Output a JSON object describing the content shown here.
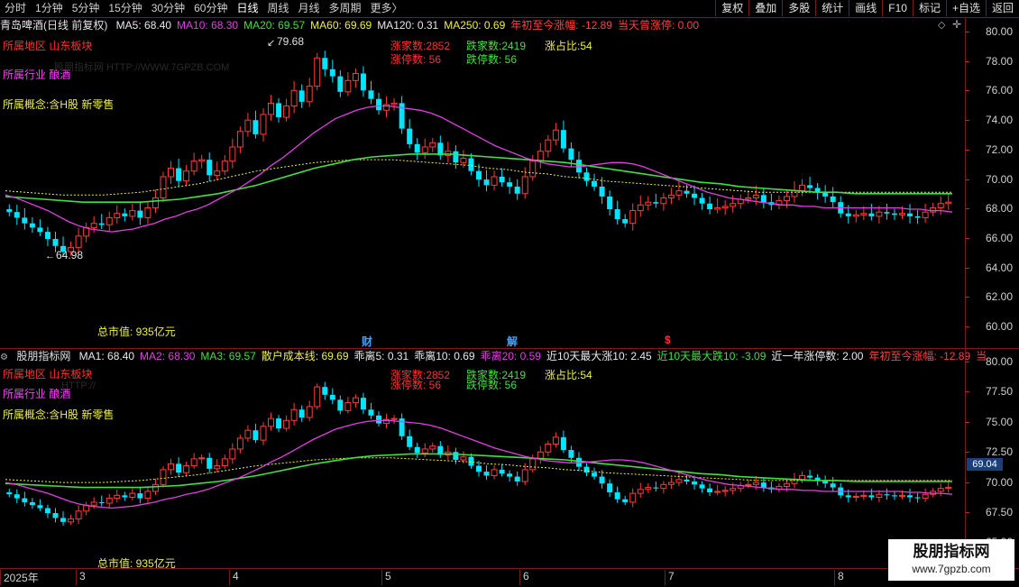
{
  "toolbar": {
    "periods": [
      "分时",
      "1分钟",
      "5分钟",
      "15分钟",
      "30分钟",
      "60分钟",
      "日线",
      "周线",
      "月线",
      "多周期",
      "更多〉"
    ],
    "active_period": "日线",
    "buttons": [
      "复权",
      "叠加",
      "多股",
      "统计",
      "画线",
      "F10",
      "标记",
      "+自选",
      "返回"
    ]
  },
  "main_header": {
    "title": "青岛啤酒(日线 前复权)",
    "items": [
      {
        "label": "MA5: 68.40",
        "color": "#e8e8e8"
      },
      {
        "label": "MA10: 68.30",
        "color": "#e040e0"
      },
      {
        "label": "MA20: 69.57",
        "color": "#40e040"
      },
      {
        "label": "MA60: 69.69",
        "color": "#f0f040"
      },
      {
        "label": "MA120: 0.31",
        "color": "#e8e8e8"
      },
      {
        "label": "MA250: 0.69",
        "color": "#f0f040"
      },
      {
        "label": "年初至今涨幅: -12.89",
        "color": "#ff4040"
      },
      {
        "label": "当天曾涨停: 0.00",
        "color": "#ff4040"
      }
    ]
  },
  "sub_header": {
    "title": "股朋指标网",
    "items": [
      {
        "label": "MA1: 68.40",
        "color": "#e8e8e8"
      },
      {
        "label": "MA2: 68.30",
        "color": "#e040e0"
      },
      {
        "label": "MA3: 69.57",
        "color": "#40e040"
      },
      {
        "label": "散户成本线: 69.69",
        "color": "#f0f040"
      },
      {
        "label": "乖离5: 0.31",
        "color": "#e8e8e8"
      },
      {
        "label": "乖离10: 0.69",
        "color": "#e8e8e8"
      },
      {
        "label": "乖离20: 0.59",
        "color": "#e040e0"
      },
      {
        "label": "近10天最大涨10: 2.45",
        "color": "#e8e8e8"
      },
      {
        "label": "近10天最大跌10: -3.09",
        "color": "#40e040"
      },
      {
        "label": "近一年涨停数: 2.00",
        "color": "#e8e8e8"
      },
      {
        "label": "年初至今涨幅: -12.89",
        "color": "#ff4040"
      },
      {
        "label": "当",
        "color": "#ff4040"
      }
    ]
  },
  "info": {
    "region": "所属地区 山东板块",
    "industry": "所属行业 酿酒",
    "concept": "所属概念:含H股 新零售",
    "market_cap": "总市值: 935亿元",
    "watermark_small": "股朋指标网 HTTP://WWW.7GPZB.COM",
    "watermark_small_sub": "HTTP://"
  },
  "stats": {
    "zhangjia": "涨家数:2852",
    "diejia": "跌家数:2419",
    "zhangzhanbi": "涨占比:54",
    "zhangting": "涨停数:      56",
    "dieting": "跌停数:      56"
  },
  "main_axis": [
    "80.00",
    "78.00",
    "76.00",
    "74.00",
    "72.00",
    "70.00",
    "68.00",
    "66.00",
    "64.00",
    "62.00",
    "60.00"
  ],
  "sub_axis": [
    "80.00",
    "77.50",
    "75.00",
    "72.50",
    "70.00",
    "67.50",
    "65.00",
    "62.50"
  ],
  "markers": {
    "cai": "财",
    "jie": "解",
    "dollar": "$"
  },
  "price_labels": {
    "high": "79.68",
    "low": "64.98"
  },
  "current_price": "69.04",
  "dates": [
    "2025年",
    "3",
    "4",
    "5",
    "6",
    "7",
    "8"
  ],
  "branding": {
    "title": "股朋指标网",
    "url": "www.7gpzb.com"
  },
  "colors": {
    "up": "#ff3c3c",
    "down": "#00e5ff",
    "ma5": "#e8e8e8",
    "ma10": "#e040e0",
    "ma20": "#40e040",
    "ma60": "#f0f040",
    "grid": "#7a1a1a"
  },
  "chart_data": {
    "type": "candlestick",
    "closes": [
      68.3,
      67.9,
      67.5,
      67.2,
      66.9,
      66.4,
      65.9,
      65.5,
      65.8,
      66.6,
      67.2,
      67.5,
      67.4,
      67.9,
      68.2,
      68.0,
      68.4,
      67.9,
      68.6,
      69.3,
      70.8,
      71.4,
      70.5,
      71.2,
      71.9,
      72.0,
      70.9,
      71.2,
      71.9,
      72.9,
      74.0,
      74.8,
      73.8,
      75.2,
      76.0,
      75.0,
      75.8,
      76.9,
      76.1,
      77.2,
      79.2,
      78.4,
      77.9,
      76.8,
      77.6,
      78.1,
      76.9,
      76.3,
      75.5,
      75.9,
      76.0,
      74.2,
      73.1,
      72.5,
      72.9,
      73.2,
      72.3,
      72.6,
      71.8,
      72.1,
      71.2,
      70.6,
      70.2,
      70.8,
      70.4,
      70.1,
      69.6,
      70.8,
      71.9,
      72.6,
      73.4,
      74.1,
      72.8,
      72.0,
      71.1,
      70.5,
      70.1,
      69.4,
      68.5,
      67.8,
      67.5,
      68.4,
      68.8,
      69.0,
      68.9,
      69.3,
      69.5,
      69.8,
      69.6,
      69.3,
      68.9,
      68.5,
      68.6,
      68.7,
      68.9,
      69.2,
      69.3,
      69.5,
      69.0,
      68.8,
      69.1,
      69.4,
      69.8,
      70.2,
      70.0,
      69.7,
      69.4,
      69.0,
      68.2,
      68.0,
      68.1,
      68.2,
      68.0,
      68.3,
      68.2,
      68.1,
      68.2,
      68.0,
      67.9,
      68.3,
      68.6,
      68.9,
      69.0
    ],
    "ma10": [
      69.5,
      69.3,
      69.0,
      68.7,
      68.4,
      68.0,
      67.6,
      67.3,
      67.1,
      67.0,
      66.9,
      67.0,
      67.1,
      67.3,
      67.5,
      67.8,
      68.0,
      68.3,
      68.5,
      68.8,
      69.2,
      69.6,
      70.0,
      70.5,
      71.0,
      71.6,
      72.1,
      72.7,
      73.3,
      73.9,
      74.4,
      74.9,
      75.2,
      75.5,
      75.7,
      75.8,
      75.8,
      75.7,
      75.6,
      75.5,
      75.3,
      75.0,
      74.6,
      74.2,
      73.8,
      73.4,
      73.0,
      72.7,
      72.4,
      72.1,
      71.9,
      71.7,
      71.6,
      71.5,
      71.5,
      71.6,
      71.7,
      71.8,
      71.8,
      71.7,
      71.5,
      71.2,
      70.9,
      70.6,
      70.3,
      70.0,
      69.7,
      69.5,
      69.3,
      69.2,
      69.1,
      69.0,
      68.9,
      68.8,
      68.8,
      68.7,
      68.7,
      68.6,
      68.6,
      68.6,
      68.6,
      68.6,
      68.6,
      68.6,
      68.6,
      68.5,
      68.5,
      68.4,
      68.4,
      68.3
    ],
    "ma20": [
      69.4,
      69.3,
      69.2,
      69.1,
      69.0,
      69.0,
      69.0,
      69.0,
      69.1,
      69.2,
      69.4,
      69.6,
      69.9,
      70.2,
      70.6,
      71.0,
      71.4,
      71.7,
      72.0,
      72.2,
      72.3,
      72.4,
      72.4,
      72.4,
      72.3,
      72.2,
      72.1,
      72.0,
      71.9,
      71.8,
      71.6,
      71.4,
      71.2,
      71.0,
      70.8,
      70.6,
      70.4,
      70.3,
      70.1,
      70.0,
      69.9,
      69.8,
      69.7,
      69.7,
      69.6,
      69.6,
      69.6,
      69.6,
      69.6,
      69.6
    ],
    "ma60": [
      69.8,
      69.7,
      69.6,
      69.5,
      69.5,
      69.5,
      69.6,
      69.7,
      69.9,
      70.1,
      70.3,
      70.6,
      70.9,
      71.2,
      71.4,
      71.6,
      71.8,
      71.9,
      72.0,
      72.0,
      72.0,
      71.9,
      71.8,
      71.7,
      71.6,
      71.4,
      71.3,
      71.1,
      71.0,
      70.8,
      70.7,
      70.5,
      70.4,
      70.3,
      70.2,
      70.1,
      70.0,
      69.9,
      69.8,
      69.7,
      69.7,
      69.7,
      69.7,
      69.7,
      69.7,
      69.7,
      69.7,
      69.7,
      69.7,
      69.7
    ],
    "main_ylim": [
      59,
      81
    ],
    "sub_ylim": [
      61,
      81.5
    ]
  }
}
